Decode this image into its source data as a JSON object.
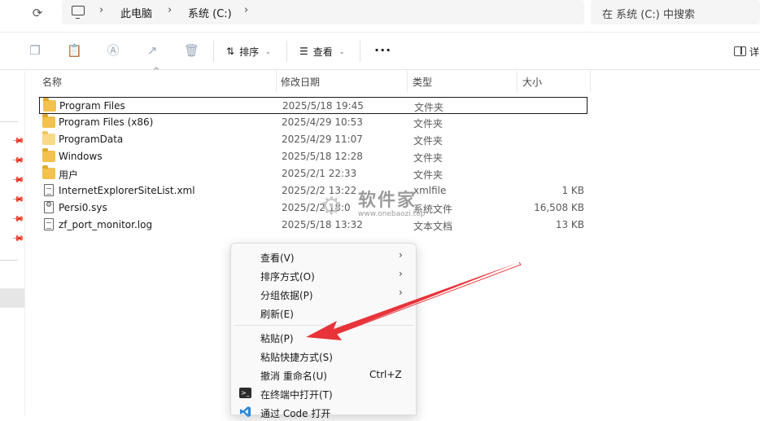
{
  "address": {
    "crumbs": [
      "此电脑",
      "系统 (C:)"
    ],
    "search_placeholder": "在 系统 (C:) 中搜索"
  },
  "toolbar": {
    "sort_label": "排序",
    "view_label": "查看",
    "right_label": "详"
  },
  "columns": [
    "名称",
    "修改日期",
    "类型",
    "大小"
  ],
  "files": [
    {
      "name": "Program Files",
      "date": "2025/5/18 19:45",
      "type": "文件夹",
      "size": "",
      "icon": "folder-icon"
    },
    {
      "name": "Program Files (x86)",
      "date": "2025/4/29 10:53",
      "type": "文件夹",
      "size": "",
      "icon": "folder-icon"
    },
    {
      "name": "ProgramData",
      "date": "2025/4/29 11:07",
      "type": "文件夹",
      "size": "",
      "icon": "folder-icon"
    },
    {
      "name": "Windows",
      "date": "2025/5/18 12:28",
      "type": "文件夹",
      "size": "",
      "icon": "folder-icon"
    },
    {
      "name": "用户",
      "date": "2025/2/1 22:33",
      "type": "文件夹",
      "size": "",
      "icon": "folder-icon"
    },
    {
      "name": "InternetExplorerSiteList.xml",
      "date": "2025/2/2 13:22",
      "type": "xmlfile",
      "size": "1 KB",
      "icon": "file-icon"
    },
    {
      "name": "Persi0.sys",
      "date": "2025/2/2 18:0",
      "type": "系统文件",
      "size": "16,508 KB",
      "icon": "system-file-icon"
    },
    {
      "name": "zf_port_monitor.log",
      "date": "2025/5/18 13:32",
      "type": "文本文档",
      "size": "13 KB",
      "icon": "text-file-icon"
    }
  ],
  "watermark": {
    "title": "软件家",
    "url": "www.onebaozi.top"
  },
  "context_menu": {
    "items": [
      {
        "label": "查看(V)",
        "submenu": true
      },
      {
        "label": "排序方式(O)",
        "submenu": true
      },
      {
        "label": "分组依据(P)",
        "submenu": true
      },
      {
        "label": "刷新(E)"
      },
      {
        "label": "粘贴(P)"
      },
      {
        "label": "粘贴快捷方式(S)"
      },
      {
        "label": "撤消 重命名(U)",
        "shortcut": "Ctrl+Z"
      },
      {
        "label": "在终端中打开(T)",
        "icon": "terminal-icon"
      },
      {
        "label": "通过 Code 打开",
        "icon": "vscode-icon"
      }
    ]
  },
  "colors": {
    "folder": "#f2c14e",
    "annotation_arrow": "#e8333a",
    "vscode_blue": "#2b8ad8"
  }
}
